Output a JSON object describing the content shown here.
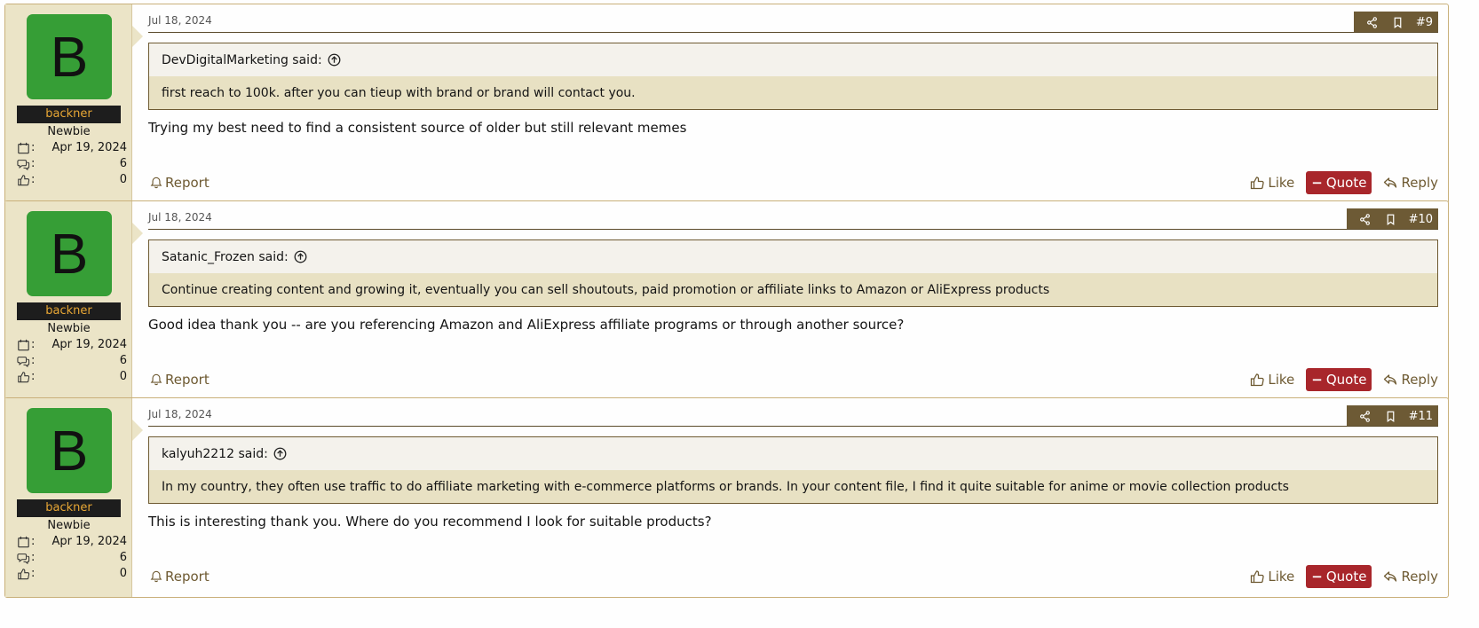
{
  "posts": [
    {
      "date": "Jul 18, 2024",
      "number": "#9",
      "avatar_letter": "B",
      "username": "backner",
      "user_title": "Newbie",
      "joined": "Apr 19, 2024",
      "messages": "6",
      "reactions": "0",
      "quote_author": "DevDigitalMarketing said:",
      "quote_text": "first reach to 100k. after you can tieup with brand or brand will contact you.",
      "message": "Trying my best need to find a consistent source of older but still relevant memes"
    },
    {
      "date": "Jul 18, 2024",
      "number": "#10",
      "avatar_letter": "B",
      "username": "backner",
      "user_title": "Newbie",
      "joined": "Apr 19, 2024",
      "messages": "6",
      "reactions": "0",
      "quote_author": "Satanic_Frozen said:",
      "quote_text": "Continue creating content and growing it, eventually you can sell shoutouts, paid promotion or affiliate links to Amazon or AliExpress products",
      "message": "Good idea thank you -- are you referencing Amazon and AliExpress affiliate programs or through another source?"
    },
    {
      "date": "Jul 18, 2024",
      "number": "#11",
      "avatar_letter": "B",
      "username": "backner",
      "user_title": "Newbie",
      "joined": "Apr 19, 2024",
      "messages": "6",
      "reactions": "0",
      "quote_author": "kalyuh2212 said:",
      "quote_text": "In my country, they often use traffic to do affiliate marketing with e-commerce platforms or brands. In your content file, I find it quite suitable for anime or movie collection products",
      "message": "This is interesting thank you. Where do you recommend I look for suitable products?"
    }
  ],
  "labels": {
    "report": "Report",
    "like": "Like",
    "quote": "Quote",
    "reply": "Reply",
    "colon": ":"
  },
  "colors": {
    "accent": "#6d5a35",
    "quote_button": "#a8262b",
    "avatar": "#369e36",
    "username_text": "#e8a735"
  },
  "icons": {
    "share": "share-icon",
    "bookmark": "bookmark-icon",
    "quote_jump": "arrow-up-circle-icon",
    "joined": "calendar-icon",
    "messages": "speech-bubbles-icon",
    "reactions": "thumbs-up-icon",
    "report": "bell-icon",
    "like": "thumbs-up-icon",
    "reply": "reply-arrow-icon"
  }
}
